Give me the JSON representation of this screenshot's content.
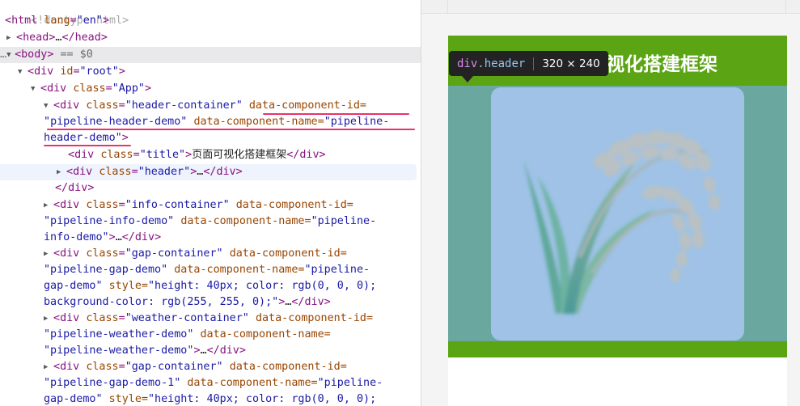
{
  "tree": {
    "doctype": "<!doctype html>",
    "html_open": {
      "tag": "html",
      "attr": "lang",
      "value": "\"en\""
    },
    "head": {
      "tag": "head",
      "dots": "…"
    },
    "body": {
      "tag": "body",
      "eq": "== $0"
    },
    "root": {
      "tag": "div",
      "attr": "id",
      "value": "\"root\""
    },
    "app": {
      "tag": "div",
      "attr": "class",
      "value": "\"App\""
    },
    "header_container": {
      "tag": "div",
      "class_attr": "class",
      "class_value": "\"header-container\"",
      "id_attr": "data-component-id=",
      "id_value_1": "\"",
      "id_value_2": "pipeline-header-demo\"",
      "name_attr": "data-component-name=",
      "name_value_1": "\"pipeline-",
      "name_value_2": "header-demo\""
    },
    "title_div": {
      "tag": "div",
      "attr": "class",
      "value": "\"title\"",
      "text": "页面可视化搭建框架"
    },
    "header_div": {
      "tag": "div",
      "attr": "class",
      "value": "\"header\"",
      "dots": "…"
    },
    "info_container": {
      "tag": "div",
      "class_attr": "class",
      "class_value": "\"info-container\"",
      "id_attr": "data-component-id=",
      "id_value": "\"pipeline-info-demo\"",
      "name_attr": "data-component-name=",
      "name_value_1": "\"pipeline-",
      "name_value_2": "info-demo\"",
      "dots": "…"
    },
    "gap_container": {
      "tag": "div",
      "class_attr": "class",
      "class_value": "\"gap-container\"",
      "id_attr": "data-component-id=",
      "id_value": "\"pipeline-gap-demo\"",
      "name_attr": "data-component-name=",
      "name_value_1": "\"pipeline-",
      "name_value_2": "gap-demo\"",
      "style_attr": "style=",
      "style_value_1": "\"height: 40px; color: rgb(0, 0, 0);",
      "style_value_2": "background-color: rgb(255, 255, 0);\"",
      "dots": "…"
    },
    "weather_container": {
      "tag": "div",
      "class_attr": "class",
      "class_value": "\"weather-container\"",
      "id_attr": "data-component-id=",
      "id_value": "\"pipeline-weather-demo\"",
      "name_attr": "data-component-name=",
      "name_value": "\"pipeline-weather-demo\"",
      "dots": "…"
    },
    "gap_container_1": {
      "tag": "div",
      "class_attr": "class",
      "class_value": "\"gap-container\"",
      "id_attr": "data-component-id=",
      "id_value": "\"pipeline-gap-demo-1\"",
      "name_attr": "data-component-name=",
      "name_value_1": "\"pipeline-",
      "name_value_2": "gap-demo\"",
      "style_attr": "style=",
      "style_value": "\"height: 40px; color: rgb(0, 0, 0);"
    }
  },
  "preview": {
    "title": "页面可视化搭建框架",
    "tooltip": {
      "tag": "div",
      "cls": ".header",
      "dims": "320 × 240"
    },
    "colors": {
      "header_green": "#5ba515",
      "overlay_teal": "#6aa89f",
      "card_blue": "#9fc2e6"
    },
    "image_icon": "rice-plant-icon"
  }
}
